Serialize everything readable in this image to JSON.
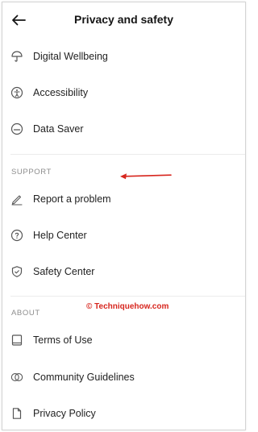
{
  "header": {
    "title": "Privacy and safety",
    "back_icon": "arrow-left-icon"
  },
  "main": {
    "top_items": [
      {
        "label": "Digital Wellbeing",
        "icon": "umbrella-icon"
      },
      {
        "label": "Accessibility",
        "icon": "accessibility-icon"
      },
      {
        "label": "Data Saver",
        "icon": "data-saver-icon"
      }
    ],
    "support": {
      "title": "SUPPORT",
      "items": [
        {
          "label": "Report a problem",
          "icon": "pencil-icon"
        },
        {
          "label": "Help Center",
          "icon": "help-icon"
        },
        {
          "label": "Safety Center",
          "icon": "shield-icon"
        }
      ]
    },
    "about": {
      "title": "ABOUT",
      "items": [
        {
          "label": "Terms of Use",
          "icon": "book-icon"
        },
        {
          "label": "Community Guidelines",
          "icon": "guidelines-icon"
        },
        {
          "label": "Privacy Policy",
          "icon": "document-icon"
        }
      ]
    }
  },
  "watermark": {
    "text": "© Techniquehow.com"
  },
  "colors": {
    "annotation": "#d7261e",
    "section_title": "#8d8d8d",
    "text": "#222222"
  }
}
